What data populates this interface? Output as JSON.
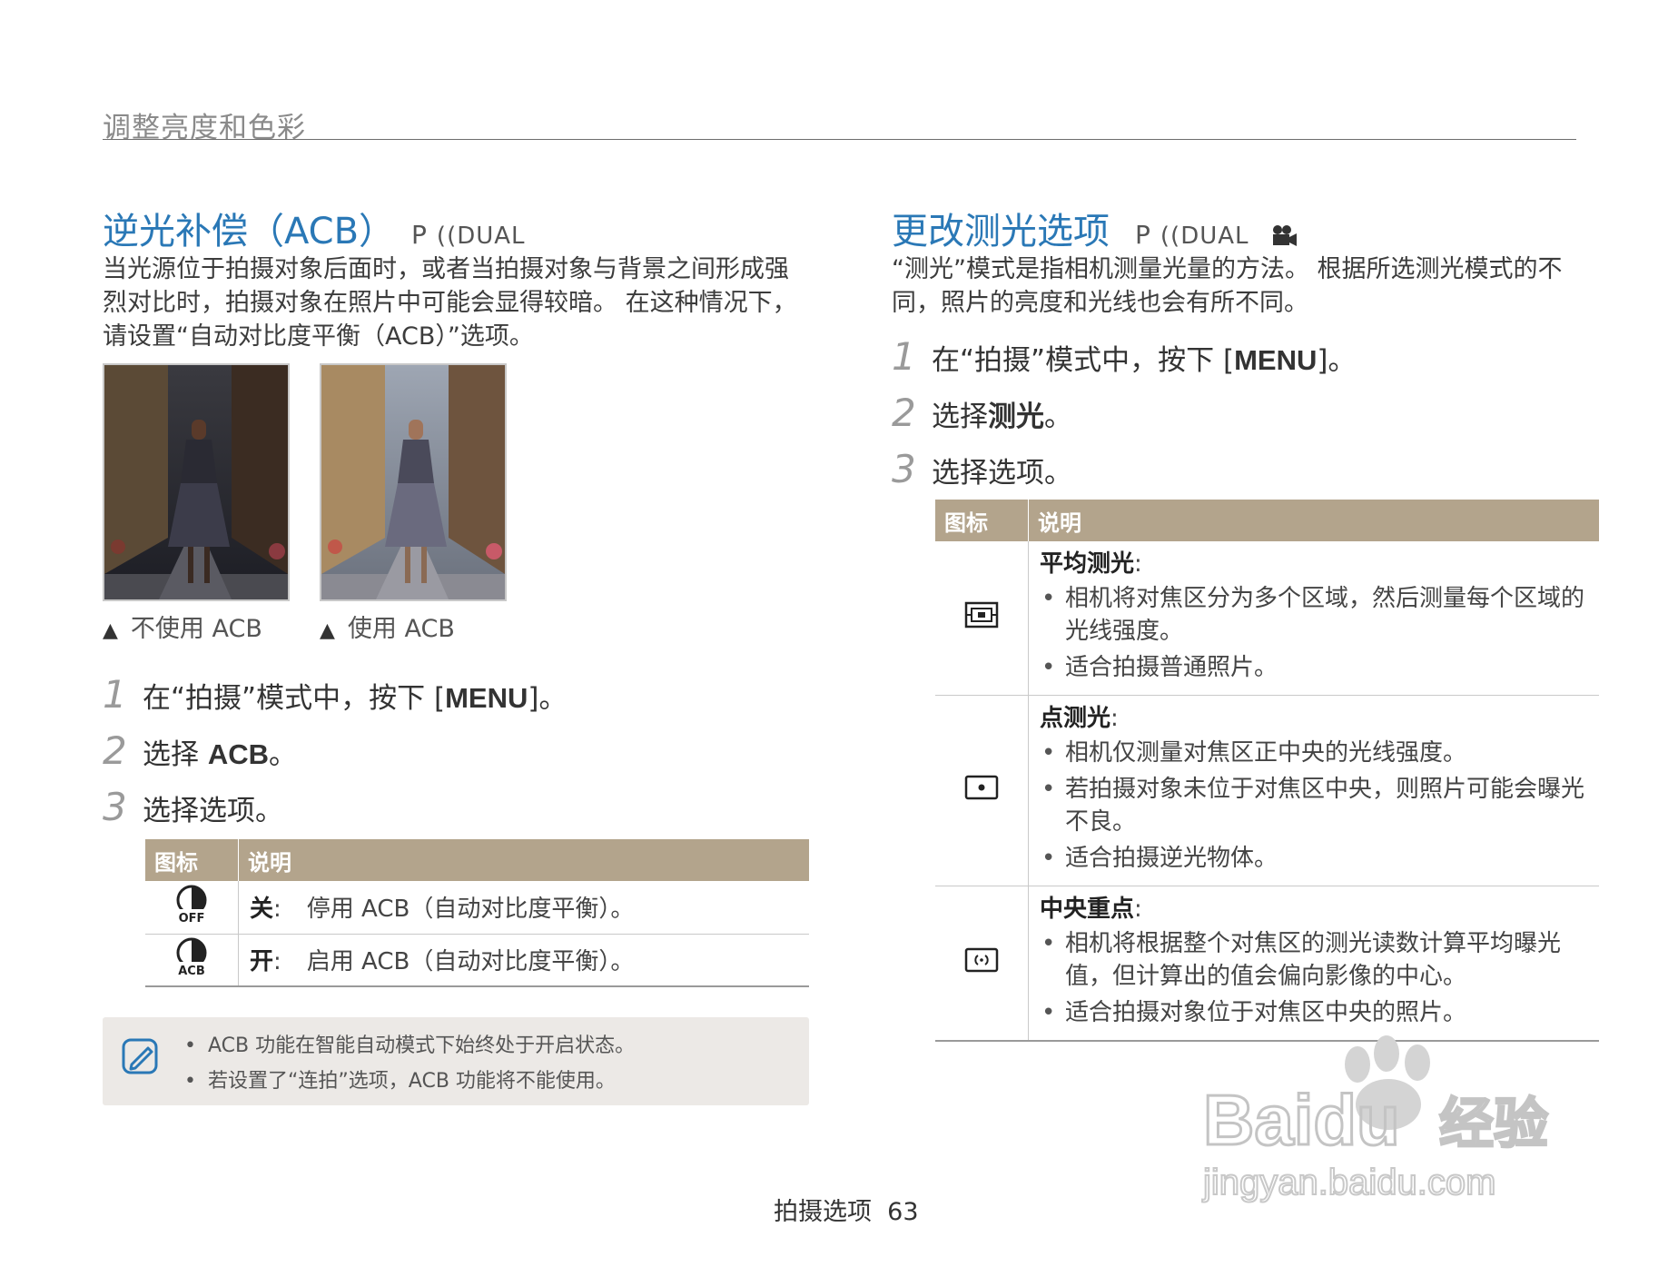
{
  "section_header": "调整亮度和色彩",
  "left": {
    "title": "逆光补偿（ACB）",
    "modes": "P",
    "modes_icon": "DUAL",
    "intro": "当光源位于拍摄对象后面时，或者当拍摄对象与背景之间形成强烈对比时，拍摄对象在照片中可能会显得较暗。 在这种情况下，请设置“自动对比度平衡（ACB）”选项。",
    "captions": [
      "不使用 ACB",
      "使用 ACB"
    ],
    "caption_marker": "▲",
    "steps": [
      {
        "num": "1",
        "pre": "在“拍摄”模式中，按下 [",
        "bold": "MENU",
        "post": "]。"
      },
      {
        "num": "2",
        "pre": "选择 ",
        "bold": "ACB",
        "post": "。"
      },
      {
        "num": "3",
        "pre": "选择选项。",
        "bold": "",
        "post": ""
      }
    ],
    "table": {
      "headers": [
        "图标",
        "说明"
      ],
      "rows": [
        {
          "icon": "acb-off-icon",
          "icon_text": "OFF",
          "label": "关",
          "text": "停用 ACB（自动对比度平衡）。"
        },
        {
          "icon": "acb-on-icon",
          "icon_text": "ACB",
          "label": "开",
          "text": "启用 ACB（自动对比度平衡）。"
        }
      ],
      "sep": ":"
    },
    "note": {
      "icon": "note-icon",
      "items": [
        "ACB 功能在智能自动模式下始终处于开启状态。",
        "若设置了“连拍”选项，ACB 功能将不能使用。"
      ]
    }
  },
  "right": {
    "title": "更改测光选项",
    "modes": "P",
    "modes_icon": "DUAL",
    "intro": "“测光”模式是指相机测量光量的方法。 根据所选测光模式的不同，照片的亮度和光线也会有所不同。",
    "steps": [
      {
        "num": "1",
        "pre": "在“拍摄”模式中，按下 [",
        "bold": "MENU",
        "post": "]。"
      },
      {
        "num": "2",
        "pre": "选择",
        "bold": "测光",
        "post": "。"
      },
      {
        "num": "3",
        "pre": "选择选项。",
        "bold": "",
        "post": ""
      }
    ],
    "table": {
      "headers": [
        "图标",
        "说明"
      ],
      "sep": ":",
      "rows": [
        {
          "icon": "multi-metering-icon",
          "title": "平均测光",
          "bullets": [
            "相机将对焦区分为多个区域，然后测量每个区域的光线强度。",
            "适合拍摄普通照片。"
          ]
        },
        {
          "icon": "spot-metering-icon",
          "title": "点测光",
          "bullets": [
            "相机仅测量对焦区正中央的光线强度。",
            "若拍摄对象未位于对焦区中央，则照片可能会曝光不良。",
            "适合拍摄逆光物体。"
          ]
        },
        {
          "icon": "center-weighted-metering-icon",
          "title": "中央重点",
          "bullets": [
            "相机将根据整个对焦区的测光读数计算平均曝光值，但计算出的值会偏向影像的中心。",
            "适合拍摄对象位于对焦区中央的照片。"
          ]
        }
      ]
    }
  },
  "footer": {
    "label": "拍摄选项",
    "page": "63"
  },
  "watermark": {
    "brand": "Baidu",
    "cn": "经验",
    "url": "jingyan.baidu.com"
  }
}
